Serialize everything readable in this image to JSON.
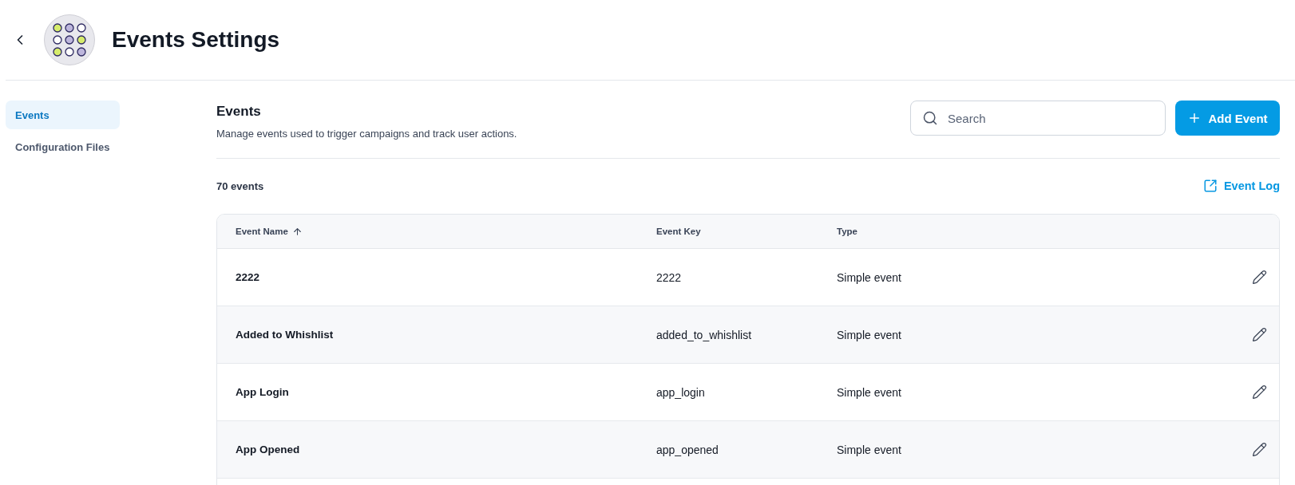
{
  "header": {
    "title": "Events Settings"
  },
  "sidebar": {
    "items": [
      {
        "label": "Events",
        "selected": true
      },
      {
        "label": "Configuration Files",
        "selected": false
      }
    ]
  },
  "section": {
    "title": "Events",
    "description": "Manage events used to trigger campaigns and track user actions.",
    "search": {
      "placeholder": "Search"
    },
    "add_button": "Add Event",
    "count": "70 events",
    "event_log_link": "Event Log"
  },
  "table": {
    "columns": [
      {
        "label": "Event Name",
        "sorted": true
      },
      {
        "label": "Event Key",
        "sorted": false
      },
      {
        "label": "Type",
        "sorted": false
      }
    ],
    "rows": [
      {
        "name": "2222",
        "key": "2222",
        "type": "Simple event"
      },
      {
        "name": "Added to Whishlist",
        "key": "added_to_whishlist",
        "type": "Simple event"
      },
      {
        "name": "App Login",
        "key": "app_login",
        "type": "Simple event"
      },
      {
        "name": "App Opened",
        "key": "app_opened",
        "type": "Simple event"
      }
    ]
  }
}
